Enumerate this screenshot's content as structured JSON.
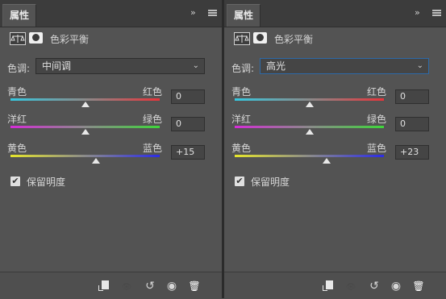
{
  "panels": [
    {
      "tab_label": "属性",
      "collapse_glyph": "››",
      "title": "色彩平衡",
      "tone_label": "色调:",
      "tone_value": "中间调",
      "sliders": [
        {
          "left": "青色",
          "right": "红色",
          "value": "0",
          "level": 0.5
        },
        {
          "left": "洋红",
          "right": "绿色",
          "value": "0",
          "level": 0.5
        },
        {
          "left": "黄色",
          "right": "蓝色",
          "value": "+15",
          "level": 0.575
        }
      ],
      "preserve_label": "保留明度",
      "preserve_checked": true
    },
    {
      "tab_label": "属性",
      "collapse_glyph": "››",
      "title": "色彩平衡",
      "tone_label": "色调:",
      "tone_value": "高光",
      "sliders": [
        {
          "left": "青色",
          "right": "红色",
          "value": "0",
          "level": 0.5
        },
        {
          "left": "洋红",
          "right": "绿色",
          "value": "0",
          "level": 0.5
        },
        {
          "left": "黄色",
          "right": "蓝色",
          "value": "+23",
          "level": 0.615
        }
      ],
      "preserve_label": "保留明度",
      "preserve_checked": true
    }
  ],
  "glyphs": {
    "check": "✔",
    "chevron": "⌄",
    "visibility": "◉",
    "reset": "↺",
    "view_previous": "👁",
    "trash": "🗑"
  },
  "colors": {
    "panel_bg": "#535353",
    "cyan": "#35c8e0",
    "red": "#e8343a",
    "magenta": "#d62cd8",
    "green": "#3ed63a",
    "yellow": "#e6e62c",
    "blue": "#2c2ce6",
    "focus_border": "#2d6aa8"
  }
}
